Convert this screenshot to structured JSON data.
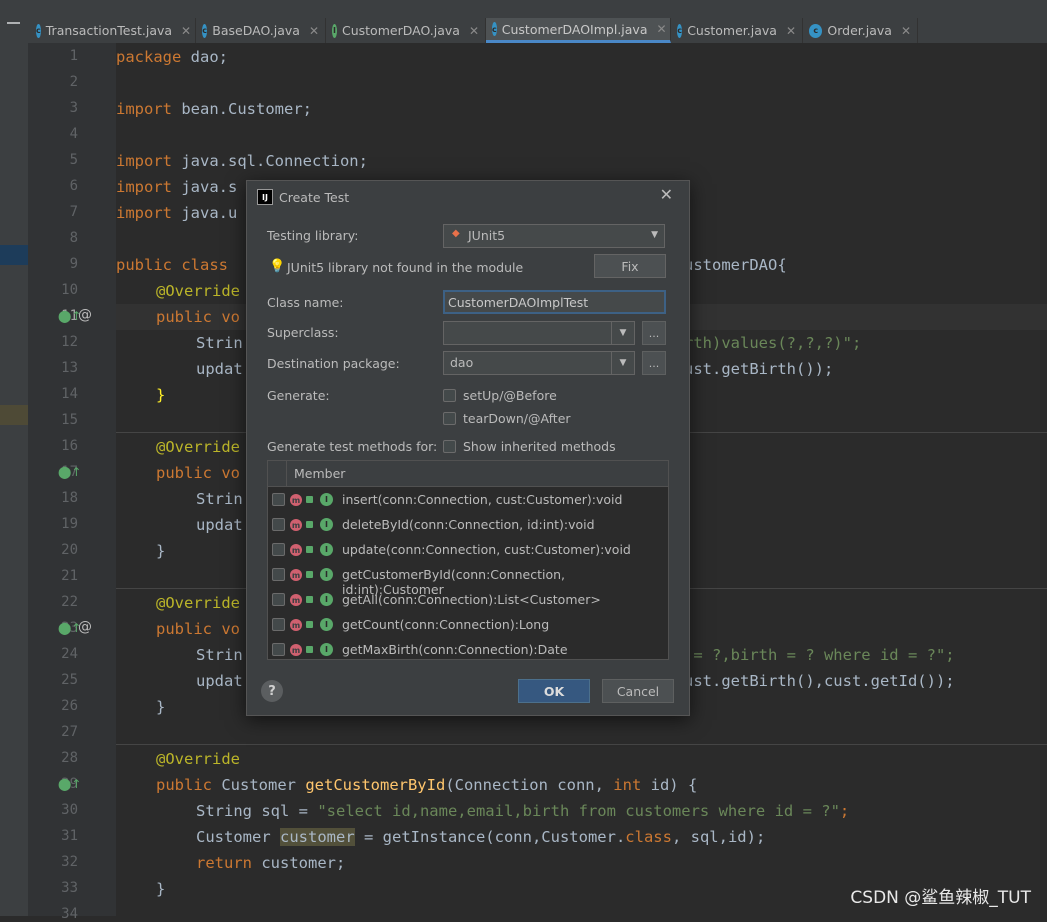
{
  "tabs": [
    {
      "label": "TransactionTest.java",
      "icon": "class-icon",
      "color": "#3592c4"
    },
    {
      "label": "BaseDAO.java",
      "icon": "abstract-class-icon",
      "color": "#3592c4"
    },
    {
      "label": "CustomerDAO.java",
      "icon": "interface-icon",
      "color": "#59a869"
    },
    {
      "label": "CustomerDAOImpl.java",
      "icon": "class-icon",
      "color": "#3592c4",
      "active": true
    },
    {
      "label": "Customer.java",
      "icon": "class-icon",
      "color": "#3592c4"
    },
    {
      "label": "Order.java",
      "icon": "class-icon",
      "color": "#3592c4"
    }
  ],
  "tab_icon_letters": {
    "class": "c",
    "abstract": "c",
    "interface": "I"
  },
  "line_numbers": [
    "1",
    "2",
    "3",
    "4",
    "5",
    "6",
    "7",
    "8",
    "9",
    "10",
    "11",
    "12",
    "13",
    "14",
    "15",
    "16",
    "17",
    "18",
    "19",
    "20",
    "21",
    "22",
    "23",
    "24",
    "25",
    "26",
    "27",
    "28",
    "29",
    "30",
    "31",
    "32",
    "33",
    "34"
  ],
  "code": {
    "l1": [
      "package",
      " dao;"
    ],
    "l3": [
      "import",
      " bean.Customer;"
    ],
    "l5": [
      "import",
      " java.sql.Connection;"
    ],
    "l6": [
      "import",
      " java.s"
    ],
    "l7": [
      "import",
      " java.u"
    ],
    "l9a": "public class",
    "l9b": "ustomerDAO{",
    "override": "@Override",
    "l11": "public vo",
    "l12a": "Strin",
    "l12b": "rth)values(?,?,?)\";",
    "l13a": "updat",
    "l13b": "ust.getBirth());",
    "l14": "}",
    "l17": "public vo",
    "l18a": "Strin",
    "l18b": ";",
    "l19": "updat",
    "l20": "}",
    "l23": "public vo",
    "l24a": "Strin",
    "l24b": " = ?,birth = ? where id = ?\";",
    "l25a": "updat",
    "l25b": "ust.getBirth(),cust.getId());",
    "l26": "}",
    "l29": [
      "public",
      " Customer ",
      "getCustomerById",
      "(Connection conn, ",
      "int",
      " id) {"
    ],
    "l30": [
      "String sql = ",
      "\"select id,name,email,birth from customers where id = ?\"",
      ";"
    ],
    "l31": [
      "Customer ",
      "customer",
      " = getInstance(conn,Customer.",
      "class",
      ", sql,id);"
    ],
    "l32": [
      "return",
      " customer;"
    ],
    "l33": "}"
  },
  "dialog": {
    "title": "Create Test",
    "testing_library_label": "Testing library:",
    "testing_library_value": "JUnit5",
    "warning": "JUnit5 library not found in the module",
    "fix_label": "Fix",
    "class_name_label": "Class name:",
    "class_name_value": "CustomerDAOImplTest",
    "superclass_label": "Superclass:",
    "superclass_value": "",
    "dest_package_label": "Destination package:",
    "dest_package_value": "dao",
    "browse_label": "...",
    "generate_label": "Generate:",
    "setup_label": "setUp/@Before",
    "teardown_label": "tearDown/@After",
    "gen_methods_label": "Generate test methods for:",
    "show_inherited_label": "Show inherited methods",
    "member_header": "Member",
    "members": [
      "insert(conn:Connection, cust:Customer):void",
      "deleteById(conn:Connection, id:int):void",
      "update(conn:Connection, cust:Customer):void",
      "getCustomerById(conn:Connection, id:int):Customer",
      "getAll(conn:Connection):List<Customer>",
      "getCount(conn:Connection):Long",
      "getMaxBirth(conn:Connection):Date"
    ],
    "ok_label": "OK",
    "cancel_label": "Cancel",
    "help_label": "?"
  },
  "watermark": "CSDN @鲨鱼辣椒_TUT"
}
